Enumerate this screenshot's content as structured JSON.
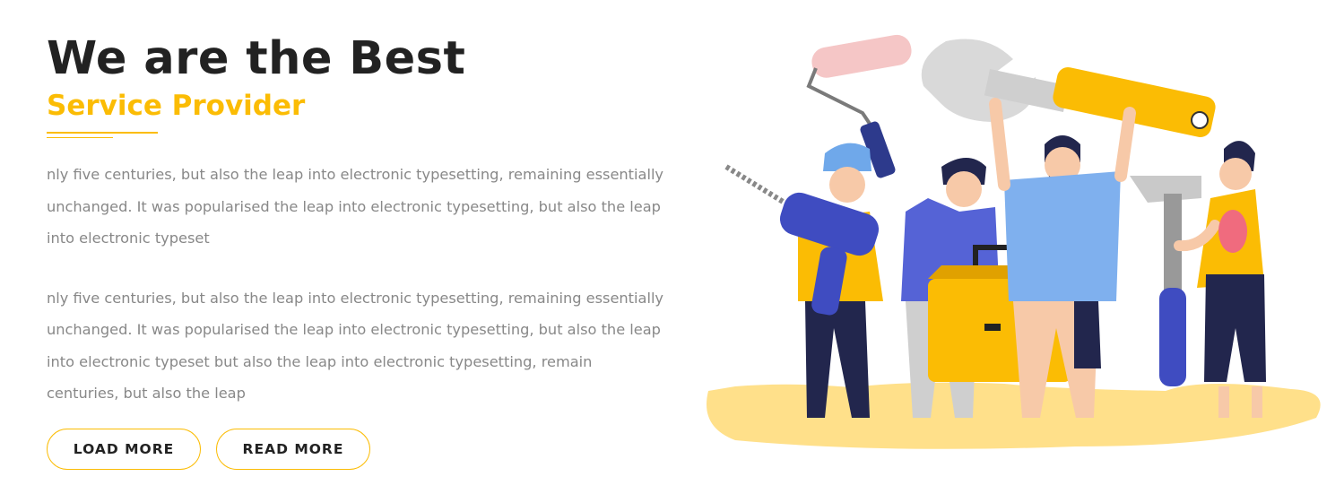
{
  "hero": {
    "title": "We are the Best",
    "subtitle": "Service Provider",
    "paragraph_1": "nly five centuries, but also the leap into electronic typesetting, remaining essentially unchanged. It was popularised the leap into electronic typesetting, but also the leap into electronic typeset",
    "paragraph_2": "nly five centuries, but also the leap into electronic typesetting, remaining essentially unchanged. It was popularised the leap into electronic typesetting, but also the leap into electronic typeset but also the leap into electronic typesetting, remain centuries, but also the leap"
  },
  "buttons": {
    "load_more": "LOAD MORE",
    "read_more": "READ MORE"
  },
  "colors": {
    "accent": "#fbbc04",
    "heading": "#222222",
    "body_text": "#888888"
  },
  "illustration": {
    "icon": "workers-with-tools-illustration"
  }
}
